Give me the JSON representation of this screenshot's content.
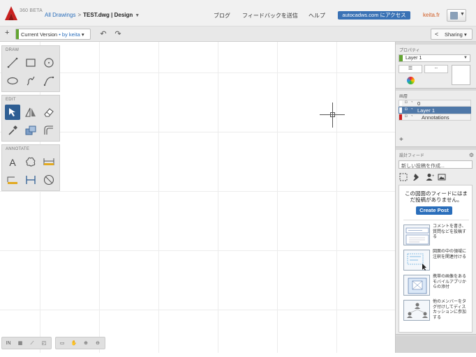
{
  "header": {
    "beta": "360 BETA",
    "crumbs": {
      "all": "All Drawings",
      "sep": ">",
      "file": "TEST.dwg | Design"
    },
    "links": [
      "ブログ",
      "フィードバックを送信",
      "ヘルプ"
    ],
    "access_button": "autocadws.com にアクセス",
    "user": "keita.fr",
    "colors": {
      "accent": "#3a72b5",
      "user": "#d05a22",
      "logo": "#c8201e"
    }
  },
  "toolbar": {
    "plus": "+",
    "version_label": "Current Version",
    "version_by": "• by keita",
    "undo": "↶",
    "redo": "↷",
    "sharing": "Sharing"
  },
  "palettes": {
    "draw": {
      "title": "DRAW",
      "tools": [
        "line-tool",
        "rectangle-tool",
        "circle-tool",
        "ellipse-tool",
        "freehand-tool",
        "polyline-tool"
      ]
    },
    "edit": {
      "title": "EDIT",
      "tools": [
        "select-tool",
        "mirror-tool",
        "eraser-tool",
        "eyedropper-tool",
        "copy-tool",
        "offset-tool"
      ]
    },
    "annotate": {
      "title": "ANNOTATE",
      "tools": [
        "text-tool",
        "cloud-tool",
        "dimension-tool",
        "hatch-tool",
        "linear-dim-tool",
        "radius-dim-tool"
      ]
    }
  },
  "statusbar": {
    "units": "IN"
  },
  "properties": {
    "title": "プロパティ",
    "layer": "Layer 1"
  },
  "layers": {
    "title": "画層",
    "items": [
      {
        "name": "0",
        "color": "#ffffff",
        "selected": false
      },
      {
        "name": "Layer 1",
        "color": "#ffffff",
        "selected": true
      },
      {
        "name": "Annotations",
        "color": "#d02020",
        "selected": false
      }
    ],
    "add": "+"
  },
  "feed": {
    "title": "設計フィード",
    "search_placeholder": "新しい投稿を作成...",
    "empty_text": "この図面のフィードにはまだ投稿がありません。",
    "create_post": "Create Post",
    "tips": [
      "コメントを書き、質問などを投稿する",
      "図面の中の領域に注釈を関連付ける",
      "携帯の画像をあるモバイルアプリからの添付",
      "他のメンバーをタグ付けしてディスカッションに参加する"
    ]
  }
}
